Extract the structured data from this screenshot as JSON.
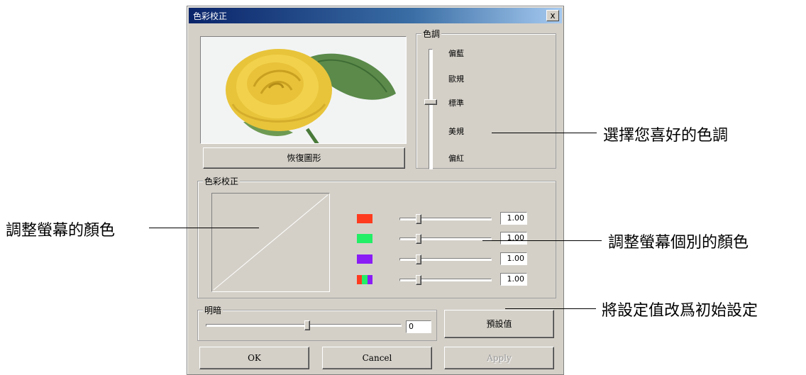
{
  "window": {
    "title": "色彩校正",
    "close_label": "x"
  },
  "preview": {
    "restore_button": "恢復圖形"
  },
  "hue_group": {
    "label": "色調",
    "levels": [
      "偏藍",
      "歐規",
      "標準",
      "美規",
      "偏紅"
    ],
    "selected": "標準"
  },
  "color_group": {
    "label": "色彩校正",
    "channels": [
      {
        "name": "red",
        "value": "1.00",
        "swatch": "#ff3b1f"
      },
      {
        "name": "green",
        "value": "1.00",
        "swatch": "#22ee66"
      },
      {
        "name": "blue",
        "value": "1.00",
        "swatch": "#8a1cf5"
      },
      {
        "name": "rgb",
        "value": "1.00",
        "swatch": "multi"
      }
    ]
  },
  "brightness": {
    "label": "明暗",
    "value": "0"
  },
  "buttons": {
    "default": "預設值",
    "ok": "OK",
    "cancel": "Cancel",
    "apply": "Apply"
  },
  "annotations": {
    "hue": "選擇您喜好的色調",
    "curve": "調整螢幕的顏色",
    "channels": "調整螢幕個別的顏色",
    "reset": "將設定值改爲初始設定"
  },
  "colors": {
    "titlebar_start": "#0a246a",
    "face": "#d4d0c8"
  }
}
